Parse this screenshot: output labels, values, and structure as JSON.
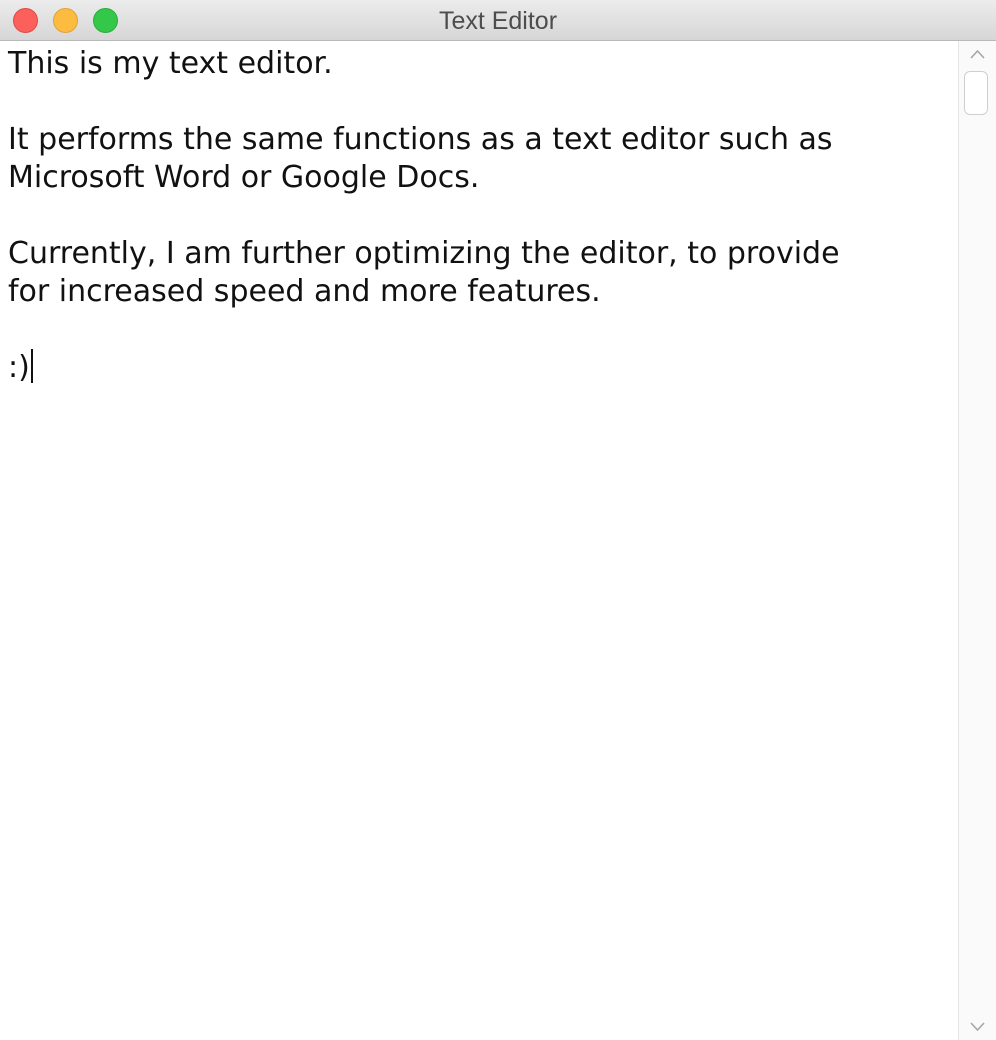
{
  "window": {
    "title": "Text Editor",
    "controls": [
      "close",
      "minimize",
      "zoom"
    ]
  },
  "editor": {
    "lines": [
      "This is my text editor.",
      "",
      "It performs the same functions as a text editor such as",
      "Microsoft Word or Google Docs.",
      "",
      "Currently, I am further optimizing the editor, to provide",
      "for increased speed and more features.",
      "",
      ":)"
    ]
  },
  "scrollbar": {
    "icons": [
      "chevron-up-icon",
      "chevron-down-icon"
    ]
  },
  "colors": {
    "close": "#fc605c",
    "minimize": "#fdbc40",
    "zoom": "#34c84a"
  }
}
